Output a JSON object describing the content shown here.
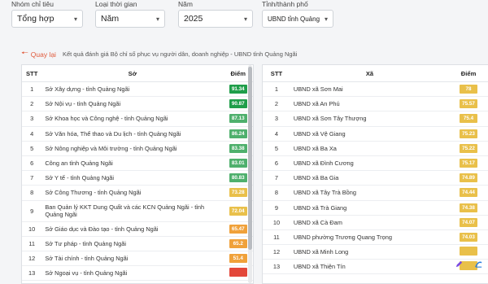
{
  "filters": {
    "group": {
      "label": "Nhóm chỉ tiêu",
      "value": "Tổng hợp"
    },
    "period": {
      "label": "Loại thời gian",
      "value": "Năm"
    },
    "year": {
      "label": "Năm",
      "value": "2025"
    },
    "province": {
      "label": "Tỉnh/thành phố",
      "value": "UBND tỉnh Quảng N..."
    }
  },
  "nav": {
    "back_label": "Quay lại",
    "page_title": "Kết quả đánh giá Bộ chỉ số phục vụ người dân, doanh nghiệp - UBND tỉnh Quảng Ngãi"
  },
  "left_table": {
    "headers": {
      "stt": "STT",
      "name": "Sở",
      "score": "Điểm"
    },
    "rows": [
      {
        "stt": "1",
        "name": "Sở Xây dựng - tỉnh Quảng Ngãi",
        "score": "91.34",
        "color": "#1f9e4a"
      },
      {
        "stt": "2",
        "name": "Sở Nội vụ - tỉnh Quảng Ngãi",
        "score": "90.87",
        "color": "#1f9e4a"
      },
      {
        "stt": "3",
        "name": "Sở Khoa học và Công nghệ - tỉnh Quảng Ngãi",
        "score": "87.13",
        "color": "#4fb06d"
      },
      {
        "stt": "4",
        "name": "Sở Văn hóa, Thể thao và Du lịch - tỉnh Quảng Ngãi",
        "score": "86.24",
        "color": "#4fb06d"
      },
      {
        "stt": "5",
        "name": "Sở Nông nghiệp và Môi trường - tỉnh Quảng Ngãi",
        "score": "83.38",
        "color": "#4fb06d"
      },
      {
        "stt": "6",
        "name": "Công an tỉnh Quảng Ngãi",
        "score": "83.01",
        "color": "#4fb06d"
      },
      {
        "stt": "7",
        "name": "Sở Y tế - tỉnh Quảng Ngãi",
        "score": "80.83",
        "color": "#4fb06d"
      },
      {
        "stt": "8",
        "name": "Sở Công Thương - tỉnh Quảng Ngãi",
        "score": "73.28",
        "color": "#e9c04a"
      },
      {
        "stt": "9",
        "name": "Ban Quản lý KKT Dung Quất và các KCN Quảng Ngãi - tỉnh Quảng Ngãi",
        "score": "72.04",
        "color": "#e9c04a"
      },
      {
        "stt": "10",
        "name": "Sở Giáo dục và Đào tạo - tỉnh Quảng Ngãi",
        "score": "65.47",
        "color": "#f0a13a"
      },
      {
        "stt": "11",
        "name": "Sở Tư pháp - tỉnh Quảng Ngãi",
        "score": "65.2",
        "color": "#f0a13a"
      },
      {
        "stt": "12",
        "name": "Sở Tài chính - tỉnh Quảng Ngãi",
        "score": "51.4",
        "color": "#f0a13a"
      },
      {
        "stt": "13",
        "name": "Sở Ngoại vụ - tỉnh Quảng Ngãi",
        "score": "",
        "color": "#e3473a"
      }
    ]
  },
  "right_table": {
    "headers": {
      "stt": "STT",
      "name": "Xã",
      "score": "Điểm"
    },
    "rows": [
      {
        "stt": "1",
        "name": "UBND xã Sơn Mai",
        "score": "78",
        "color": "#e9c04a"
      },
      {
        "stt": "2",
        "name": "UBND xã An Phú",
        "score": "75.57",
        "color": "#e9c04a"
      },
      {
        "stt": "3",
        "name": "UBND xã Sơn Tây Thượng",
        "score": "75.4",
        "color": "#e9c04a"
      },
      {
        "stt": "4",
        "name": "UBND xã Vệ Giang",
        "score": "75.23",
        "color": "#e9c04a"
      },
      {
        "stt": "5",
        "name": "UBND xã Ba Xa",
        "score": "75.22",
        "color": "#e9c04a"
      },
      {
        "stt": "6",
        "name": "UBND xã Đình Cương",
        "score": "75.17",
        "color": "#e9c04a"
      },
      {
        "stt": "7",
        "name": "UBND xã Ba Gia",
        "score": "74.89",
        "color": "#e9c04a"
      },
      {
        "stt": "8",
        "name": "UBND xã Tây Trà Bồng",
        "score": "74.44",
        "color": "#e9c04a"
      },
      {
        "stt": "9",
        "name": "UBND xã Trà Giang",
        "score": "74.38",
        "color": "#e9c04a"
      },
      {
        "stt": "10",
        "name": "UBND xã Cà Đam",
        "score": "74.07",
        "color": "#e9c04a"
      },
      {
        "stt": "11",
        "name": "UBND phường Trương Quang Trọng",
        "score": "74.03",
        "color": "#e9c04a"
      },
      {
        "stt": "12",
        "name": "UBND xã Minh Long",
        "score": "",
        "color": "#e9c04a"
      },
      {
        "stt": "13",
        "name": "UBND xã Thiện Tín",
        "score": "",
        "color": "#e9c04a"
      }
    ]
  },
  "icons": {
    "back": "arrow-left-icon",
    "chevron": "chevron-down-icon",
    "pen": "pen-icon",
    "chart": "chart-icon"
  }
}
